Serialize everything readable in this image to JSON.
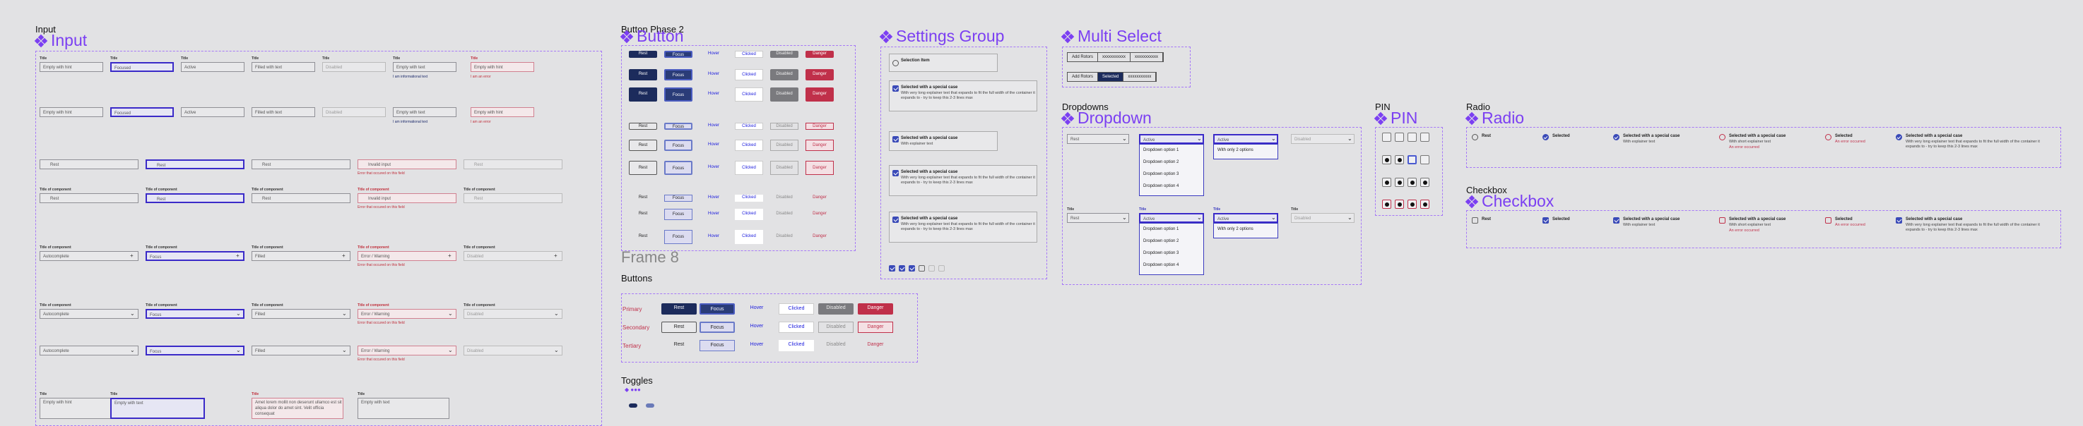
{
  "labels": {
    "input_small": "Input",
    "input_title": "Input",
    "button_phase_small": "Button Phase 2",
    "button_title": "Button",
    "frame8": "Frame 8",
    "buttons_small": "Buttons",
    "toggles_small": "Toggles",
    "settings_title": "Settings Group",
    "multiselect_title": "Multi Select",
    "dropdowns_small": "Dropdowns",
    "dropdown_title": "Dropdown",
    "pin_small": "PIN",
    "pin_title": "PIN",
    "radio_small": "Radio",
    "radio_title": "Radio",
    "checkbox_small": "Checkbox",
    "checkbox_title": "Checkbox"
  },
  "input": {
    "title": "Title",
    "component_title": "Title of component",
    "row1": [
      "Empty with hint",
      "Focused",
      "Active",
      "Filled with text",
      "Disabled",
      "Empty with text",
      "Empty with hint"
    ],
    "info_msg": "I am informational text",
    "error_msg": "I am an error",
    "search_row": [
      "Rest",
      "Rest",
      "Rest",
      "Invalid input",
      "Rest"
    ],
    "field_error": "Error that occured on this field",
    "auto_row": [
      "Autocomplete",
      "Focus",
      "Filled",
      "Error / Warning",
      "Disabled"
    ],
    "textarea": [
      "Empty with hint",
      "Empty with text",
      "Amet lorem mollit non deserunt ullamco est sit aliqua dolor do amet sint. Velit officia consequat",
      "Empty with text"
    ]
  },
  "buttons": {
    "states": [
      "Rest",
      "Focus",
      "Hover",
      "Clicked",
      "Disabled",
      "Danger"
    ],
    "row_labels": [
      "Primary",
      "Secondary",
      "Tertiary"
    ]
  },
  "settings": {
    "items": [
      {
        "title": "Selection Item",
        "desc": ""
      },
      {
        "title": "Selected with a special case",
        "desc": "With very long explainer text that expands to fit the full width of the container it expands to - try to keep this 2-3 lines max"
      },
      {
        "title": "Selected with a special case",
        "desc": "With explainer text"
      },
      {
        "title": "Selected with a special case",
        "desc": "With very long explainer text that expands to fit the full width of the container it expands to - try to keep this 2-3 lines max"
      },
      {
        "title": "Selected with a special case",
        "desc": "With very long explainer text that expands to fit the full width of the container it expands to - try to keep this 2-3 lines max"
      }
    ]
  },
  "multiselect": {
    "row1": [
      "Add Rotors",
      "xxxxxxxxxxx",
      "xxxxxxxxxxx"
    ],
    "row2": [
      "Add Rotors",
      "Selected",
      "xxxxxxxxxxx"
    ]
  },
  "dropdown": {
    "title": "Title",
    "rest": "Rest",
    "active": "Active",
    "disabled": "Disabled",
    "options": [
      "Dropdown option 1",
      "Dropdown option 2",
      "Dropdown option 3",
      "Dropdown option 4"
    ],
    "only2": "With only 2 options"
  },
  "radio": {
    "items": [
      {
        "title": "Rest",
        "desc": "",
        "err": ""
      },
      {
        "title": "Selected",
        "desc": "",
        "err": ""
      },
      {
        "title": "Selected with a special case",
        "desc": "With explainer text",
        "err": ""
      },
      {
        "title": "Selected with a special case",
        "desc": "With short explainer text",
        "err": "An error occurred"
      },
      {
        "title": "Selected",
        "desc": "",
        "err": "An error occurred"
      },
      {
        "title": "Selected with a special case",
        "desc": "With very long explainer text that expands to fit the full width of the container it expands to - try to keep this 2-3 lines max",
        "err": ""
      }
    ]
  },
  "checkbox": {
    "items": [
      {
        "title": "Rest",
        "desc": "",
        "err": ""
      },
      {
        "title": "Selected",
        "desc": "",
        "err": ""
      },
      {
        "title": "Selected with a special case",
        "desc": "With explainer text",
        "err": ""
      },
      {
        "title": "Selected with a special case",
        "desc": "With short explainer text",
        "err": "An error occurred"
      },
      {
        "title": "Selected",
        "desc": "",
        "err": "An error occurred"
      },
      {
        "title": "Selected with a special case",
        "desc": "With very long explainer text that expands to fit the full width of the container it expands to - try to keep this 2-3 lines max",
        "err": ""
      }
    ]
  },
  "colors": {
    "accent": "#7b3ff2",
    "primary": "#1c2b5c",
    "danger": "#c0304a",
    "link": "#1a1add"
  }
}
